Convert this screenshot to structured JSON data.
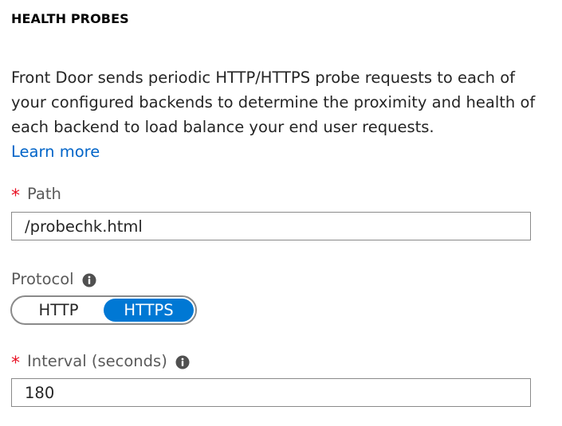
{
  "section": {
    "heading": "HEALTH PROBES",
    "description": "Front Door sends periodic HTTP/HTTPS probe requests to each of your configured backends to determine the proximity and health of each backend to load balance your end user requests.",
    "learn_more": "Learn more"
  },
  "path": {
    "required_mark": "*",
    "label": "Path",
    "value": "/probechk.html"
  },
  "protocol": {
    "label": "Protocol",
    "info_icon": "info-icon",
    "options": [
      "HTTP",
      "HTTPS"
    ],
    "selected": "HTTPS"
  },
  "interval": {
    "required_mark": "*",
    "label": "Interval (seconds)",
    "info_icon": "info-icon",
    "value": "180"
  },
  "colors": {
    "accent": "#0078d4",
    "link": "#0064c8",
    "required": "#e81123"
  }
}
